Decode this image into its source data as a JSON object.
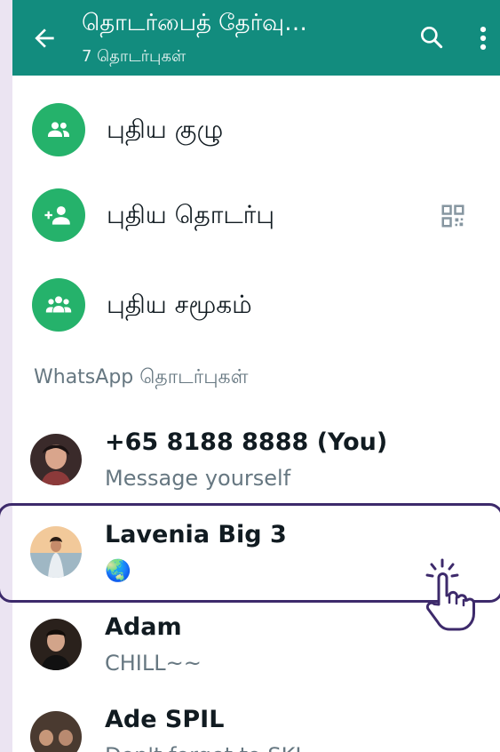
{
  "appbar": {
    "title": "தொடர்பைத் தேர்வு…",
    "subtitle": "7 தொடர்புகள்",
    "back_icon": "arrow-back-icon",
    "search_icon": "search-icon",
    "more_icon": "more-vert-icon"
  },
  "actions": [
    {
      "label": "புதிய குழு",
      "icon": "group-icon"
    },
    {
      "label": "புதிய தொடர்பு",
      "icon": "person-add-icon",
      "trailing_icon": "qr-code-icon"
    },
    {
      "label": "புதிய சமூகம்",
      "icon": "community-icon"
    }
  ],
  "section_header": "WhatsApp தொடர்புகள்",
  "contacts": [
    {
      "name": "+65 8188 8888 (You)",
      "status": "Message yourself"
    },
    {
      "name": "Lavenia Big 3",
      "status": "🌏"
    },
    {
      "name": "Adam",
      "status": "CHILL~~"
    },
    {
      "name": "Ade SPIL",
      "status": "Don't forget to SKI"
    }
  ],
  "colors": {
    "appbar": "#128c7e",
    "accent_green": "#25b26b",
    "highlight_border": "#3d2a6b",
    "secondary_text": "#667781"
  }
}
